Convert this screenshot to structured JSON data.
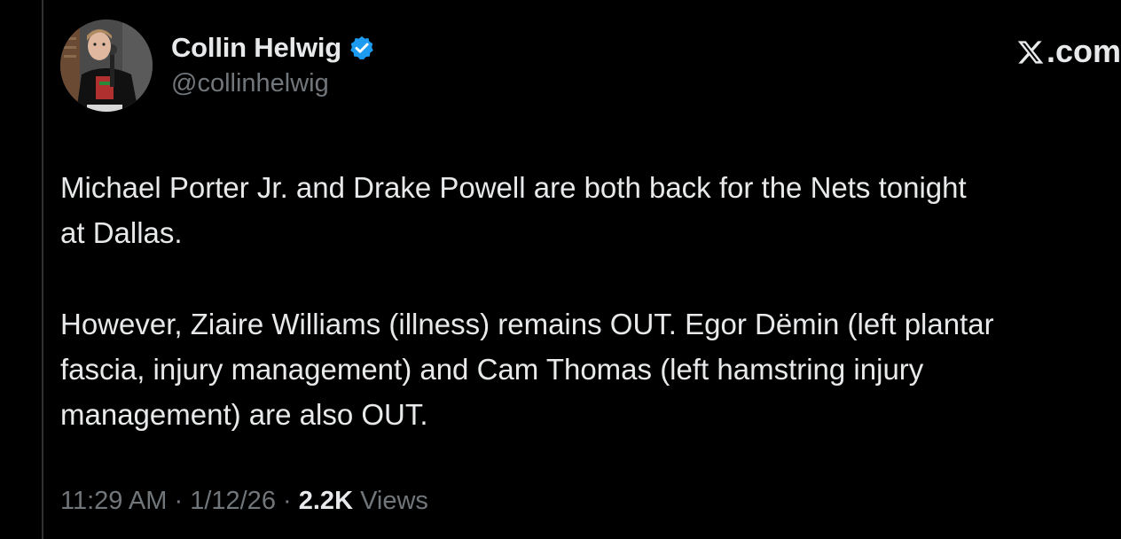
{
  "author": {
    "display_name": "Collin Helwig",
    "handle": "@collinhelwig",
    "verified": true
  },
  "branding": {
    "site_label": ".com",
    "logo_icon": "x-logo-icon"
  },
  "tweet": {
    "paragraphs": [
      [
        "Michael Porter Jr. and Drake Powell are both back for the Nets tonight",
        "at Dallas."
      ],
      [
        "However, Ziaire Williams (illness) remains OUT. Egor Dëmin (left plantar",
        "fascia, injury management) and Cam  Thomas (left hamstring injury",
        "management) are also OUT."
      ]
    ]
  },
  "meta": {
    "time": "11:29 AM",
    "separator": "·",
    "date": "1/12/26",
    "views_count": "2.2K",
    "views_label": "Views"
  },
  "colors": {
    "background": "#000000",
    "text_primary": "#e7e9ea",
    "text_secondary": "#71767b",
    "verified_blue": "#1d9bf0"
  }
}
